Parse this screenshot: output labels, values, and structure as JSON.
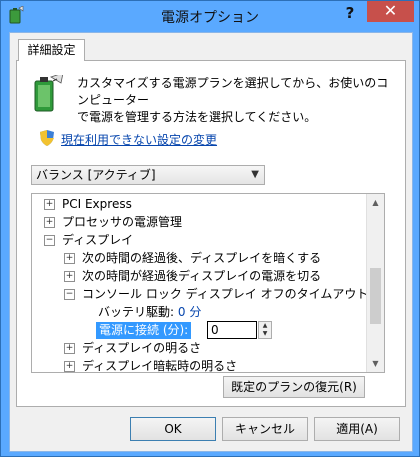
{
  "window": {
    "title": "電源オプション",
    "help_label": "?",
    "close_label": "✕"
  },
  "tab": {
    "label": "詳細設定"
  },
  "description": "カスタマイズする電源プランを選択してから、お使いのコンピューター\nで電源を管理する方法を選択してください。",
  "link": "現在利用できない設定の変更",
  "plan_select": {
    "value": "バランス [アクティブ]"
  },
  "tree": {
    "nodes": [
      {
        "label": "PCI Express",
        "expander": "+"
      },
      {
        "label": "プロセッサの電源管理",
        "expander": "+"
      },
      {
        "label": "ディスプレイ",
        "expander": "−"
      },
      {
        "label": "次の時間の経過後、ディスプレイを暗くする",
        "expander": "+"
      },
      {
        "label": "次の時間が経過後ディスプレイの電源を切る",
        "expander": "+"
      },
      {
        "label": "コンソール ロック ディスプレイ オフのタイムアウト",
        "expander": "−"
      },
      {
        "label": "ディスプレイの明るさ",
        "expander": "+"
      },
      {
        "label": "ディスプレイ暗転時の明るさ",
        "expander": "+"
      }
    ],
    "battery_label": "バッテリ駆動:",
    "battery_value": "0 分",
    "plugged_label": "電源に接続 (分):",
    "plugged_value": "0"
  },
  "buttons": {
    "restore": "既定のプランの復元(R)",
    "ok": "OK",
    "cancel": "キャンセル",
    "apply": "適用(A)"
  },
  "colors": {
    "titlebar": "#5aa9ff",
    "close": "#c7504b",
    "selection": "#3399ff",
    "link": "#0645ad"
  }
}
